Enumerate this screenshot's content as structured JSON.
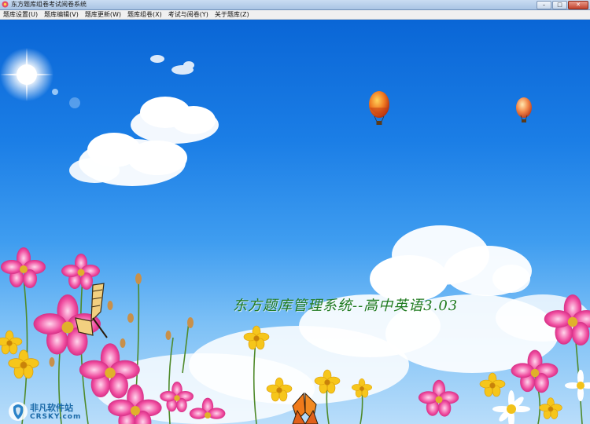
{
  "window": {
    "title": "东方题库组卷考试阅卷系统",
    "minimize": "–",
    "maximize": "□",
    "close": "✕"
  },
  "menu": [
    {
      "label": "题库设置(U)"
    },
    {
      "label": "题库编辑(V)"
    },
    {
      "label": "题库更新(W)"
    },
    {
      "label": "题库组卷(X)"
    },
    {
      "label": "考试与阅卷(Y)"
    },
    {
      "label": "关于题库(Z)"
    }
  ],
  "splash": {
    "title": "东方题库管理系统--高中英语3.03"
  },
  "watermark": {
    "brand": "非凡软件站",
    "sub": "CRSKY.com"
  },
  "colors": {
    "sky_top": "#0a66d6",
    "sky_bottom": "#b9ddfa",
    "title_green": "#1f7a1f"
  }
}
